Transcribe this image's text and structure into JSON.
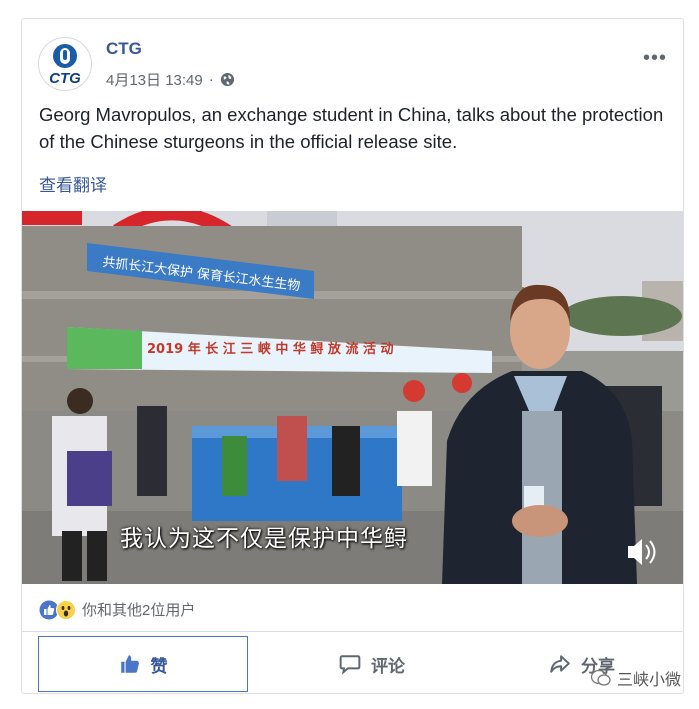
{
  "post": {
    "page_name": "CTG",
    "avatar_text": "CTG",
    "timestamp": "4月13日 13:49",
    "separator": "·",
    "text": "Georg Mavropulos, an exchange student in China, talks about the protection of the Chinese sturgeons in the official release site.",
    "translate_label": "查看翻译",
    "more_label": "•••"
  },
  "video": {
    "banner_top": "共抓长江大保护  保育长江水生生物",
    "banner_main": "2019 年 长 江 三 峡 中 华 鲟 放 流 活 动",
    "subtitle": "我认为这不仅是保护中华鲟"
  },
  "reactions": {
    "summary": "你和其他2位用户"
  },
  "actions": {
    "like": "赞",
    "comment": "评论",
    "share": "分享"
  },
  "watermark": "三峡小微",
  "colors": {
    "link": "#365899",
    "like_icon": "#4a76c8",
    "border": "#dddfe2"
  }
}
